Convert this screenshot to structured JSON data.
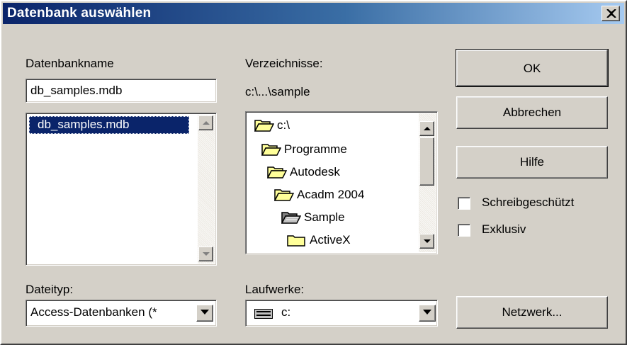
{
  "window": {
    "title": "Datenbank auswählen",
    "close_icon": "close-icon"
  },
  "database_name": {
    "label": "Datenbankname",
    "value": "db_samples.mdb",
    "list_items": [
      {
        "label": "db_samples.mdb",
        "selected": true
      }
    ]
  },
  "directories": {
    "label": "Verzeichnisse:",
    "current_path": "c:\\...\\sample",
    "tree": [
      {
        "label": "c:\\",
        "icon": "folder-open-icon"
      },
      {
        "label": "Programme",
        "icon": "folder-open-icon"
      },
      {
        "label": "Autodesk",
        "icon": "folder-open-icon"
      },
      {
        "label": "Acadm 2004",
        "icon": "folder-open-icon"
      },
      {
        "label": "Sample",
        "icon": "folder-open-dark-icon"
      },
      {
        "label": "ActiveX",
        "icon": "folder-closed-icon"
      }
    ]
  },
  "file_type": {
    "label": "Dateityp:",
    "value": "Access-Datenbanken (*"
  },
  "drives": {
    "label": "Laufwerke:",
    "value": "c:",
    "icon": "drive-icon"
  },
  "buttons": {
    "ok": "OK",
    "cancel": "Abbrechen",
    "help": "Hilfe",
    "network": "Netzwerk..."
  },
  "options": {
    "read_only": {
      "label": "Schreibgeschützt",
      "checked": false
    },
    "exclusive": {
      "label": "Exklusiv",
      "checked": false
    }
  }
}
